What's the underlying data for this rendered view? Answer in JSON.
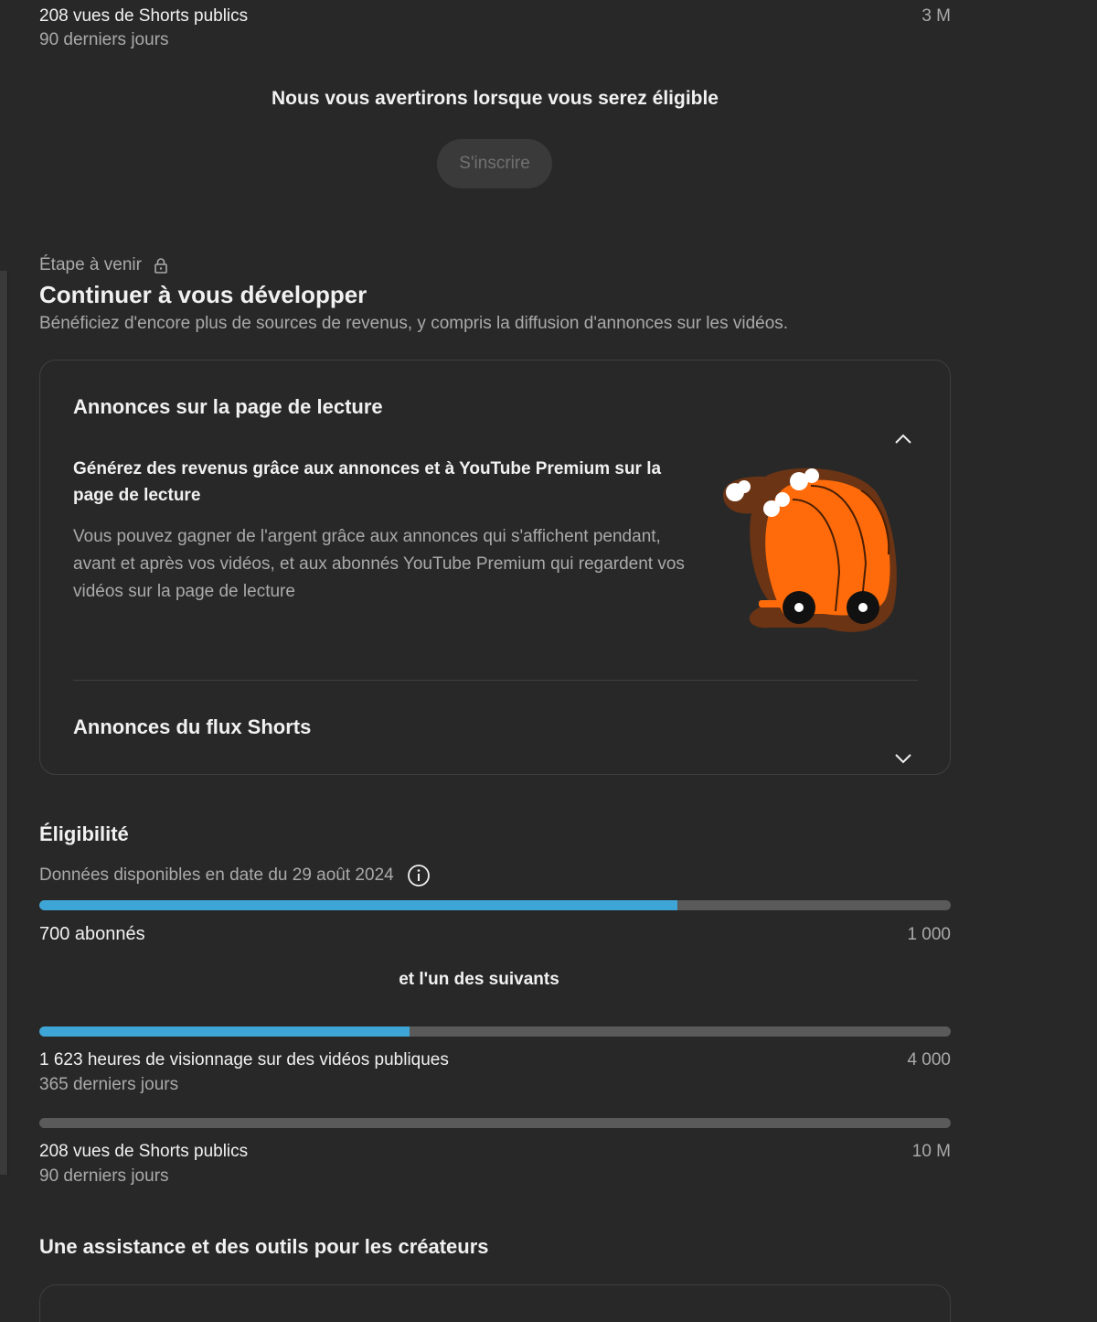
{
  "top_stat": {
    "label": "208 vues de Shorts publics",
    "sub": "90 derniers jours",
    "value": "3 M"
  },
  "notify": {
    "text": "Nous vous avertirons lorsque vous serez éligible",
    "button": "S'inscrire"
  },
  "stage": {
    "label": "Étape à venir",
    "title": "Continuer à vous développer",
    "description": "Bénéficiez d'encore plus de sources de revenus, y compris la diffusion d'annonces sur les vidéos."
  },
  "card": {
    "section1_title": "Annonces sur la page de lecture",
    "section1_subtitle": "Générez des revenus grâce aux annonces et à YouTube Premium sur la page de lecture",
    "section1_body": "Vous pouvez gagner de l'argent grâce aux annonces qui s'affichent pendant, avant et après vos vidéos, et aux abonnés YouTube Premium qui regardent vos vidéos sur la page de lecture",
    "section2_title": "Annonces du flux Shorts",
    "icons": {
      "collapse": "chevron-up-icon",
      "expand": "chevron-down-icon",
      "illustration": "orange-cart-illustration"
    }
  },
  "eligibility": {
    "title": "Éligibilité",
    "date": "Données disponibles en date du 29 août 2024",
    "info_icon": "info-icon",
    "and_one": "et l'un des suivants",
    "accent_color": "#3ea6d6",
    "track_color": "#5a5a5a",
    "subscribers": {
      "label": "700 abonnés",
      "target": "1 000",
      "progress": 0.7
    },
    "watch_hours": {
      "label": "1 623 heures de visionnage sur des vidéos publiques",
      "sub": "365 derniers jours",
      "target": "4 000",
      "progress": 0.4058
    },
    "shorts_views": {
      "label": "208 vues de Shorts publics",
      "sub": "90 derniers jours",
      "target": "10 M",
      "progress": 0.0
    }
  },
  "tools": {
    "title": "Une assistance et des outils pour les créateurs"
  }
}
